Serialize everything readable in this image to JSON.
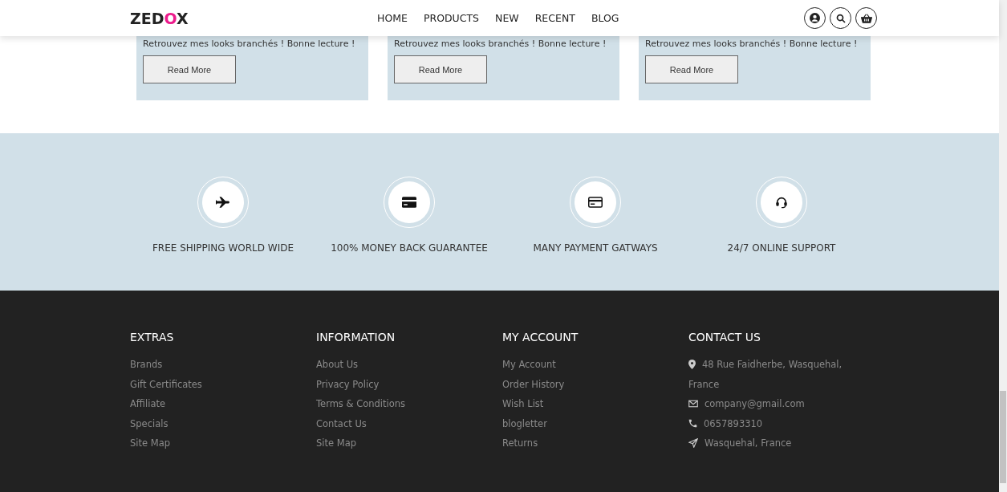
{
  "header": {
    "logo": [
      {
        "text": "ZED",
        "accent": false
      },
      {
        "text": "O",
        "accent": true
      },
      {
        "text": "X",
        "accent": false
      }
    ],
    "nav": [
      "HOME",
      "PRODUCTS",
      "NEW",
      "RECENT",
      "BLOG"
    ],
    "actions": [
      {
        "kind": "user"
      },
      {
        "kind": "search"
      },
      {
        "kind": "basket"
      }
    ]
  },
  "blog_cards": [
    {
      "excerpt": "Retrouvez mes looks branchés ! Bonne lecture !",
      "button": "Read More"
    },
    {
      "excerpt": "Retrouvez mes looks branchés ! Bonne lecture !",
      "button": "Read More"
    },
    {
      "excerpt": "Retrouvez mes looks branchés ! Bonne lecture !",
      "button": "Read More"
    }
  ],
  "features": [
    {
      "kind": "plane",
      "label": "FREE SHIPPING WORLD WIDE"
    },
    {
      "kind": "card",
      "label": "100% MONEY BACK GUARANTEE"
    },
    {
      "kind": "payment",
      "label": "MANY PAYMENT GATWAYS"
    },
    {
      "kind": "headset",
      "label": "24/7 ONLINE SUPPORT"
    }
  ],
  "footer": {
    "columns": [
      {
        "title": "EXTRAS",
        "links": [
          "Brands",
          "Gift Certificates",
          "Affiliate",
          "Specials",
          "Site Map"
        ]
      },
      {
        "title": "INFORMATION",
        "links": [
          "About Us",
          "Privacy Policy",
          "Terms & Conditions",
          "Contact Us",
          "Site Map"
        ]
      },
      {
        "title": "MY ACCOUNT",
        "links": [
          "My Account",
          "Order History",
          "Wish List",
          "blogletter",
          "Returns"
        ]
      }
    ],
    "contact": {
      "title": "CONTACT US",
      "items": [
        {
          "kind": "pin",
          "lines": [
            "48 Rue Faidherbe, Wasquehal,",
            "France"
          ]
        },
        {
          "kind": "mail",
          "lines": [
            "company@gmail.com"
          ]
        },
        {
          "kind": "phone",
          "lines": [
            "0657893310"
          ]
        },
        {
          "kind": "send",
          "lines": [
            "Wasquehal, France"
          ]
        }
      ]
    }
  }
}
